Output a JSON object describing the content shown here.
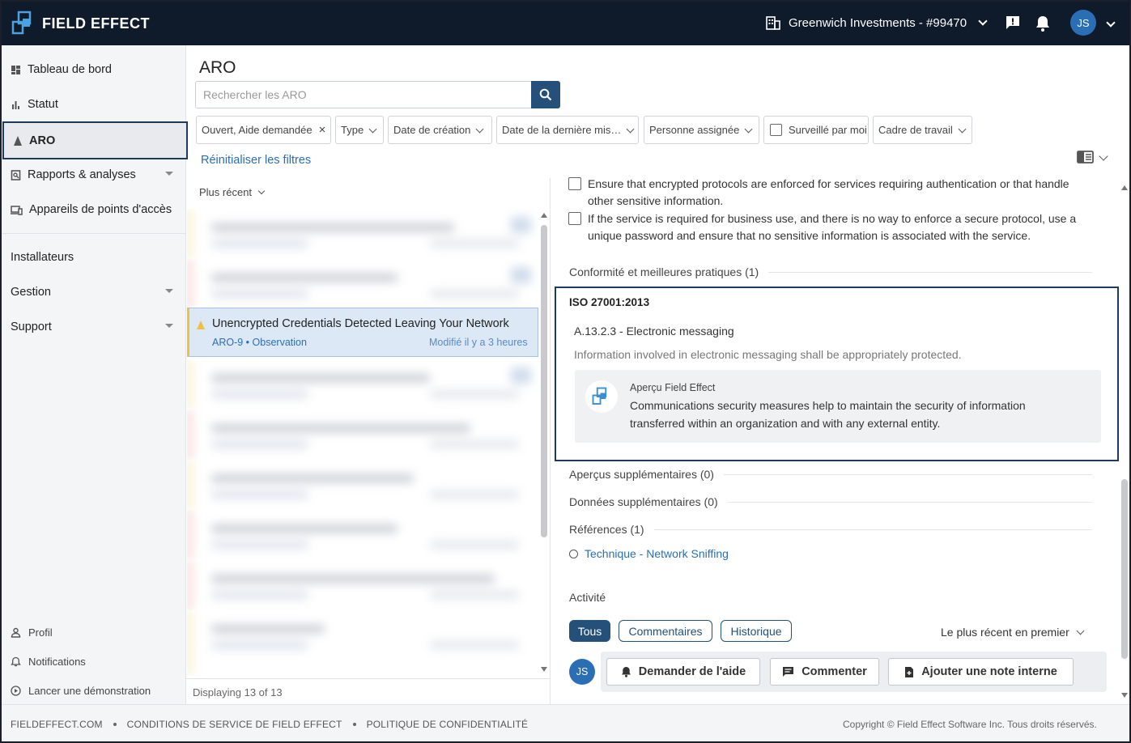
{
  "brand": {
    "name": "FIELD EFFECT"
  },
  "topbar": {
    "org": "Greenwich Investments - #99470",
    "avatar": "JS"
  },
  "sidebar": {
    "items": [
      {
        "label": "Tableau de bord",
        "icon": "dashboard-icon"
      },
      {
        "label": "Statut",
        "icon": "bar-chart-icon"
      },
      {
        "label": "ARO",
        "icon": "aro-icon"
      },
      {
        "label": "Rapports & analyses",
        "icon": "report-icon"
      },
      {
        "label": "Appareils de points d'accès",
        "icon": "devices-icon"
      },
      {
        "label": "Installateurs"
      },
      {
        "label": "Gestion"
      },
      {
        "label": "Support"
      }
    ],
    "bottom": [
      {
        "label": "Profil",
        "icon": "user-icon"
      },
      {
        "label": "Notifications",
        "icon": "bell-icon"
      },
      {
        "label": "Lancer une démonstration",
        "icon": "play-icon"
      }
    ]
  },
  "main": {
    "title": "ARO",
    "search_placeholder": "Rechercher les ARO",
    "filters": {
      "status": "Ouvert, Aide demandée",
      "type": "Type",
      "created": "Date de création",
      "modified": "Date de la dernière mis…",
      "assignee": "Personne assignée",
      "watched": "Surveillé par moi",
      "framework": "Cadre de travail"
    },
    "reset": "Réinitialiser les filtres"
  },
  "list": {
    "sort": "Plus récent",
    "selected": {
      "title": "Unencrypted Credentials Detected Leaving Your Network",
      "sub": "ARO-9 • Observation",
      "time": "Modifié il y a 3 heures"
    },
    "footer": "Displaying 13 of 13"
  },
  "detail": {
    "checks": [
      "Ensure that encrypted protocols are enforced for services requiring authentication or that handle other sensitive information.",
      "If the service is required for business use, and there is no way to enforce a secure protocol, use a unique password and ensure that no sensitive information is associated with the service."
    ],
    "compliance_head": "Conformité et meilleures pratiques (1)",
    "iso": {
      "title": "ISO 27001:2013",
      "control": "A.13.2.3 - Electronic messaging",
      "description": "Information involved in electronic messaging shall be appropriately protected.",
      "insight_label": "Aperçu Field Effect",
      "insight_text": "Communications security measures help to maintain the security of information transferred within an organization and with any external entity."
    },
    "extra_insights": "Aperçus supplémentaires (0)",
    "extra_data": "Données supplémentaires (0)",
    "references": "Références (1)",
    "ref_link": "Technique - Network Sniffing",
    "activity": {
      "label": "Activité",
      "tabs": [
        "Tous",
        "Commentaires",
        "Historique"
      ],
      "order": "Le plus récent en premier",
      "avatar": "JS",
      "buttons": [
        "Demander de l'aide",
        "Commenter",
        "Ajouter une note interne"
      ]
    }
  },
  "footer": {
    "links": [
      "FIELDEFFECT.COM",
      "CONDITIONS DE SERVICE DE FIELD EFFECT",
      "POLITIQUE DE CONFIDENTIALITÉ"
    ],
    "copyright": "Copyright © Field Effect Software Inc. Tous droits réservés."
  },
  "colors": {
    "topbar": "#0f1a2a",
    "accent": "#24507a",
    "link": "#2a6fb5",
    "warning": "#f0c040"
  }
}
